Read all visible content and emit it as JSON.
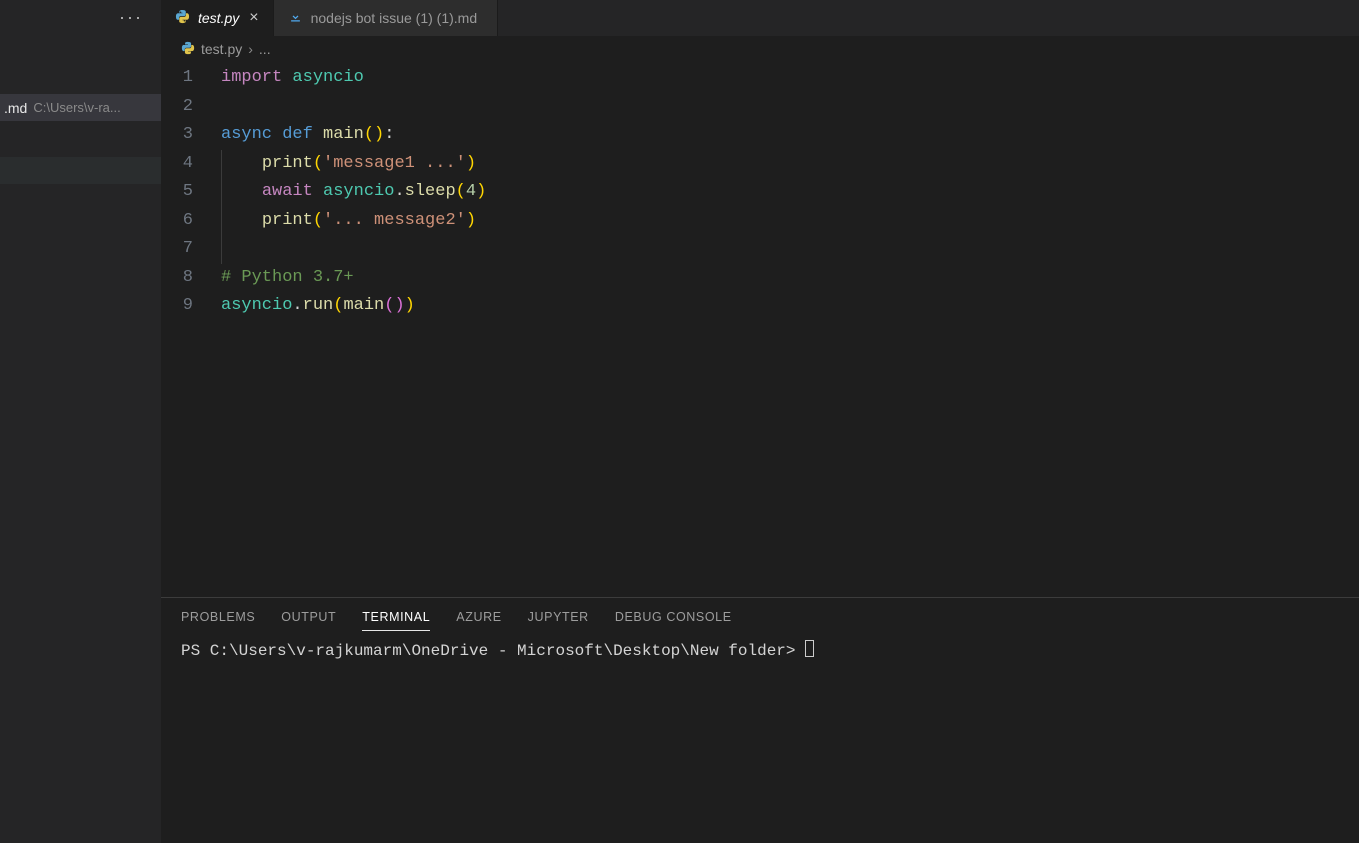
{
  "sidebar": {
    "ellipsis": "···",
    "item": {
      "name": ".md",
      "path": "C:\\Users\\v-ra..."
    }
  },
  "tabs": {
    "active": {
      "icon_name": "python-file-icon",
      "label": "test.py",
      "close": "×"
    },
    "other": {
      "icon_name": "download-file-icon",
      "label": "nodejs bot issue (1) (1).md"
    }
  },
  "breadcrumb": {
    "file": "test.py",
    "chev": "›",
    "rest": "..."
  },
  "editor": {
    "gutter": [
      "1",
      "2",
      "3",
      "4",
      "5",
      "6",
      "7",
      "8",
      "9"
    ],
    "active_line_index": 6,
    "lines": [
      [
        [
          "kw",
          "import"
        ],
        [
          "def",
          " "
        ],
        [
          "mod",
          "asyncio"
        ]
      ],
      [],
      [
        [
          "bkw",
          "async"
        ],
        [
          "def",
          " "
        ],
        [
          "bkw",
          "def"
        ],
        [
          "def",
          " "
        ],
        [
          "fn",
          "main"
        ],
        [
          "paren",
          "()"
        ],
        [
          "def",
          ":"
        ]
      ],
      [
        [
          "def",
          "    "
        ],
        [
          "fn",
          "print"
        ],
        [
          "paren",
          "("
        ],
        [
          "str",
          "'message1 ...'"
        ],
        [
          "paren",
          ")"
        ]
      ],
      [
        [
          "def",
          "    "
        ],
        [
          "kw",
          "await"
        ],
        [
          "def",
          " "
        ],
        [
          "mod",
          "asyncio"
        ],
        [
          "def",
          "."
        ],
        [
          "fn",
          "sleep"
        ],
        [
          "paren",
          "("
        ],
        [
          "num",
          "4"
        ],
        [
          "paren",
          ")"
        ]
      ],
      [
        [
          "def",
          "    "
        ],
        [
          "fn",
          "print"
        ],
        [
          "paren",
          "("
        ],
        [
          "str",
          "'... message2'"
        ],
        [
          "paren",
          ")"
        ]
      ],
      [],
      [
        [
          "cmt",
          "# Python 3.7+"
        ]
      ],
      [
        [
          "mod",
          "asyncio"
        ],
        [
          "def",
          "."
        ],
        [
          "fn",
          "run"
        ],
        [
          "paren",
          "("
        ],
        [
          "fn",
          "main"
        ],
        [
          "parenP",
          "()"
        ],
        [
          "paren",
          ")"
        ]
      ]
    ]
  },
  "panel": {
    "tabs": [
      "PROBLEMS",
      "OUTPUT",
      "TERMINAL",
      "AZURE",
      "JUPYTER",
      "DEBUG CONSOLE"
    ],
    "active_tab": 2,
    "prompt": "PS C:\\Users\\v-rajkumarm\\OneDrive - Microsoft\\Desktop\\New folder> "
  }
}
